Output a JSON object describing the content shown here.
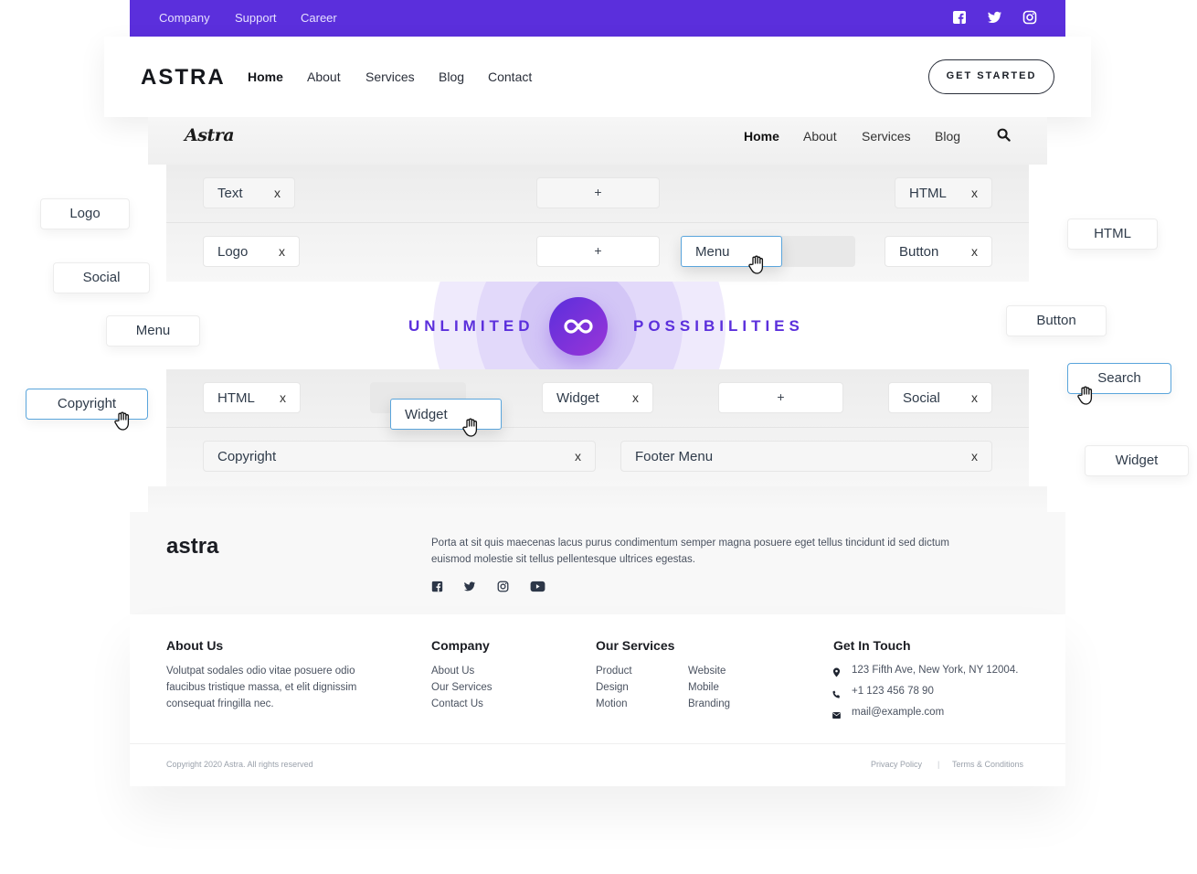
{
  "topbar": {
    "links": [
      "Company",
      "Support",
      "Career"
    ],
    "social_icons": [
      "facebook-icon",
      "twitter-icon",
      "instagram-icon"
    ],
    "color": "#5b2fdc"
  },
  "header": {
    "brand": "ASTRA",
    "nav": [
      "Home",
      "About",
      "Services",
      "Blog",
      "Contact"
    ],
    "active": "Home",
    "cta": "GET STARTED"
  },
  "header2": {
    "brand": "Astra",
    "nav": [
      "Home",
      "About",
      "Services",
      "Blog"
    ],
    "active": "Home",
    "search_icon": "search-icon"
  },
  "builder": {
    "header_row1": {
      "left": "Text",
      "center_plus": "+",
      "right": "HTML"
    },
    "header_row2": {
      "left": "Logo",
      "center_plus": "+",
      "dragging": "Menu",
      "right": "Button"
    },
    "footer_row1": {
      "left": "HTML",
      "dragging": "Widget",
      "center": "Widget",
      "center_plus": "+",
      "right": "Social"
    },
    "footer_row2": {
      "left": "Copyright",
      "right": "Footer Menu"
    },
    "remove_label": "x"
  },
  "floating_tags": {
    "left": [
      "Logo",
      "Social",
      "Menu",
      "Copyright"
    ],
    "right": [
      "HTML",
      "Button",
      "Search",
      "Widget"
    ],
    "active": [
      "Copyright",
      "Search"
    ]
  },
  "banner": {
    "left_text": "UNLIMITED",
    "right_text": "POSSIBILITIES",
    "icon": "infinity-icon"
  },
  "footer": {
    "logo": "astra",
    "description": "Porta at sit quis maecenas lacus purus condimentum semper magna posuere eget tellus tincidunt id sed dictum euismod molestie sit tellus pellentesque ultrices egestas.",
    "social_icons": [
      "facebook-icon",
      "twitter-icon",
      "instagram-icon",
      "youtube-icon"
    ],
    "about": {
      "title": "About Us",
      "text": "Volutpat sodales odio vitae posuere odio faucibus tristique massa, et elit dignissim consequat fringilla nec."
    },
    "company": {
      "title": "Company",
      "links": [
        "About Us",
        "Our Services",
        "Contact Us"
      ]
    },
    "services": {
      "title": "Our Services",
      "col1": [
        "Product",
        "Design",
        "Motion"
      ],
      "col2": [
        "Website",
        "Mobile",
        "Branding"
      ]
    },
    "contact": {
      "title": "Get In Touch",
      "address": "123 Fifth Ave, New York, NY 12004.",
      "phone": "+1 123 456 78 90",
      "email": "mail@example.com"
    },
    "copyright": "Copyright 2020 Astra. All rights reserved",
    "privacy": "Privacy Policy",
    "separator": "|",
    "terms": "Terms & Conditions"
  }
}
